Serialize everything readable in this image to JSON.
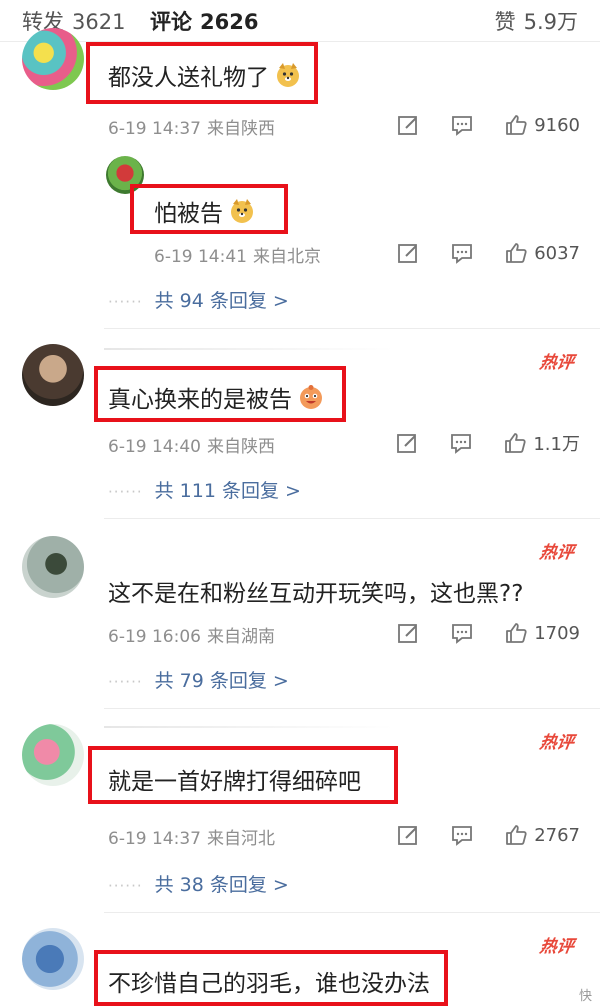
{
  "tabs": {
    "repost_label": "转发",
    "repost_count": "3621",
    "comment_label": "评论",
    "comment_count": "2626",
    "like_label": "赞",
    "like_count": "5.9万"
  },
  "comments": [
    {
      "text": "都没人送礼物了",
      "time": "6-19 14:37",
      "location": "来自陕西",
      "likes": "9160"
    },
    {
      "text": "怕被告",
      "time": "6-19 14:41",
      "location": "来自北京",
      "likes": "6037",
      "replies": "共 94 条回复 >"
    },
    {
      "hot": "热评",
      "text": "真心换来的是被告",
      "time": "6-19 14:40",
      "location": "来自陕西",
      "likes": "1.1万",
      "replies": "共 111 条回复 >"
    },
    {
      "hot": "热评",
      "text": "这不是在和粉丝互动开玩笑吗，这也黑??",
      "time": "6-19 16:06",
      "location": "来自湖南",
      "likes": "1709",
      "replies": "共 79 条回复 >"
    },
    {
      "hot": "热评",
      "text": "就是一首好牌打得细碎吧",
      "time": "6-19 14:37",
      "location": "来自河北",
      "likes": "2767",
      "replies": "共 38 条回复 >"
    },
    {
      "hot": "热评",
      "text": "不珍惜自己的羽毛，谁也没办法"
    }
  ],
  "reply_dots": "······",
  "watermark": "快",
  "colors": {
    "highlight_box": "#e8111a",
    "link_blue": "#4a6d9e",
    "hot_red": "#e8483a",
    "meta_gray": "#8e8e8e"
  },
  "icons": [
    "edit-icon",
    "message-icon",
    "thumbs-up-icon",
    "doge-emoji-icon",
    "blush-emoji-icon"
  ]
}
